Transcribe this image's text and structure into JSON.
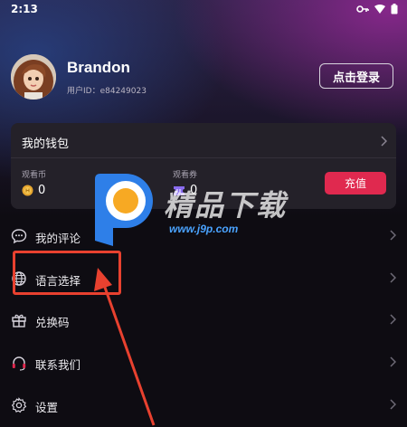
{
  "status_bar": {
    "time": "2:13"
  },
  "profile": {
    "username": "Brandon",
    "user_id": "用户ID：e84249023",
    "login_label": "点击登录"
  },
  "wallet": {
    "title": "我的钱包",
    "coins_label": "观看币",
    "coins_value": "0",
    "tickets_label": "观看券",
    "tickets_value": "0",
    "recharge_label": "充值",
    "recharge_color": "#e0294f"
  },
  "menu": {
    "items": [
      {
        "label": "我的评论",
        "icon": "comment-icon"
      },
      {
        "label": "语言选择",
        "icon": "globe-icon"
      },
      {
        "label": "兑换码",
        "icon": "gift-icon"
      },
      {
        "label": "联系我们",
        "icon": "headset-icon"
      },
      {
        "label": "设置",
        "icon": "gear-icon"
      }
    ]
  },
  "watermark": {
    "text": "精品下载",
    "url": "www.j9p.com"
  },
  "annotation": {
    "highlight_color": "#e8412f"
  }
}
